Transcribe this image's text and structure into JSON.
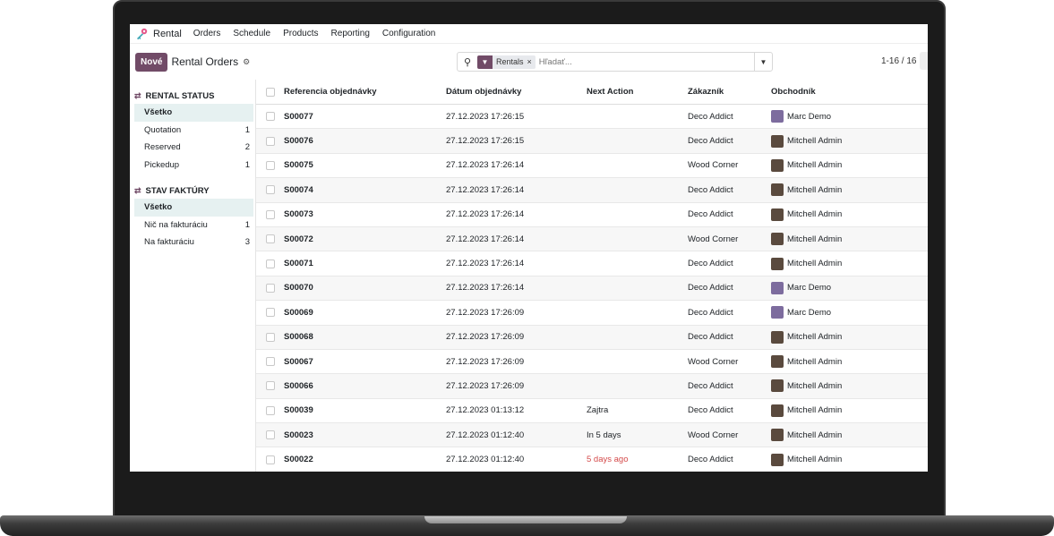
{
  "nav": {
    "app_name": "Rental",
    "menu": [
      "Orders",
      "Schedule",
      "Products",
      "Reporting",
      "Configuration"
    ]
  },
  "control": {
    "new_label": "Nové",
    "title": "Rental Orders",
    "facet": "Rentals",
    "search_placeholder": "Hľadať...",
    "pager": "1-16 / 16"
  },
  "sidebar": {
    "sections": [
      {
        "title": "RENTAL STATUS",
        "items": [
          {
            "label": "Všetko",
            "count": ""
          },
          {
            "label": "Quotation",
            "count": "1"
          },
          {
            "label": "Reserved",
            "count": "2"
          },
          {
            "label": "Pickedup",
            "count": "1"
          }
        ]
      },
      {
        "title": "STAV FAKTÚRY",
        "items": [
          {
            "label": "Všetko",
            "count": ""
          },
          {
            "label": "Nič na fakturáciu",
            "count": "1"
          },
          {
            "label": "Na fakturáciu",
            "count": "3"
          }
        ]
      }
    ]
  },
  "table": {
    "columns": [
      "Referencia objednávky",
      "Dátum objednávky",
      "Next Action",
      "Zákazník",
      "Obchodník"
    ],
    "rows": [
      {
        "ref": "S00077",
        "date": "27.12.2023 17:26:15",
        "next": "",
        "customer": "Deco Addict",
        "salesperson": "Marc Demo"
      },
      {
        "ref": "S00076",
        "date": "27.12.2023 17:26:15",
        "next": "",
        "customer": "Deco Addict",
        "salesperson": "Mitchell Admin"
      },
      {
        "ref": "S00075",
        "date": "27.12.2023 17:26:14",
        "next": "",
        "customer": "Wood Corner",
        "salesperson": "Mitchell Admin"
      },
      {
        "ref": "S00074",
        "date": "27.12.2023 17:26:14",
        "next": "",
        "customer": "Deco Addict",
        "salesperson": "Mitchell Admin"
      },
      {
        "ref": "S00073",
        "date": "27.12.2023 17:26:14",
        "next": "",
        "customer": "Deco Addict",
        "salesperson": "Mitchell Admin"
      },
      {
        "ref": "S00072",
        "date": "27.12.2023 17:26:14",
        "next": "",
        "customer": "Wood Corner",
        "salesperson": "Mitchell Admin"
      },
      {
        "ref": "S00071",
        "date": "27.12.2023 17:26:14",
        "next": "",
        "customer": "Deco Addict",
        "salesperson": "Mitchell Admin"
      },
      {
        "ref": "S00070",
        "date": "27.12.2023 17:26:14",
        "next": "",
        "customer": "Deco Addict",
        "salesperson": "Marc Demo"
      },
      {
        "ref": "S00069",
        "date": "27.12.2023 17:26:09",
        "next": "",
        "customer": "Deco Addict",
        "salesperson": "Marc Demo"
      },
      {
        "ref": "S00068",
        "date": "27.12.2023 17:26:09",
        "next": "",
        "customer": "Deco Addict",
        "salesperson": "Mitchell Admin"
      },
      {
        "ref": "S00067",
        "date": "27.12.2023 17:26:09",
        "next": "",
        "customer": "Wood Corner",
        "salesperson": "Mitchell Admin"
      },
      {
        "ref": "S00066",
        "date": "27.12.2023 17:26:09",
        "next": "",
        "customer": "Deco Addict",
        "salesperson": "Mitchell Admin"
      },
      {
        "ref": "S00039",
        "date": "27.12.2023 01:13:12",
        "next": "Zajtra",
        "customer": "Deco Addict",
        "salesperson": "Mitchell Admin"
      },
      {
        "ref": "S00023",
        "date": "27.12.2023 01:12:40",
        "next": "In 5 days",
        "customer": "Wood Corner",
        "salesperson": "Mitchell Admin"
      },
      {
        "ref": "S00022",
        "date": "27.12.2023 01:12:40",
        "next": "5 days ago",
        "customer": "Deco Addict",
        "salesperson": "Mitchell Admin"
      }
    ]
  },
  "colors": {
    "brand": "#714b67",
    "overdue": "#d44a4a",
    "active_filter_bg": "#e6f1f1"
  }
}
